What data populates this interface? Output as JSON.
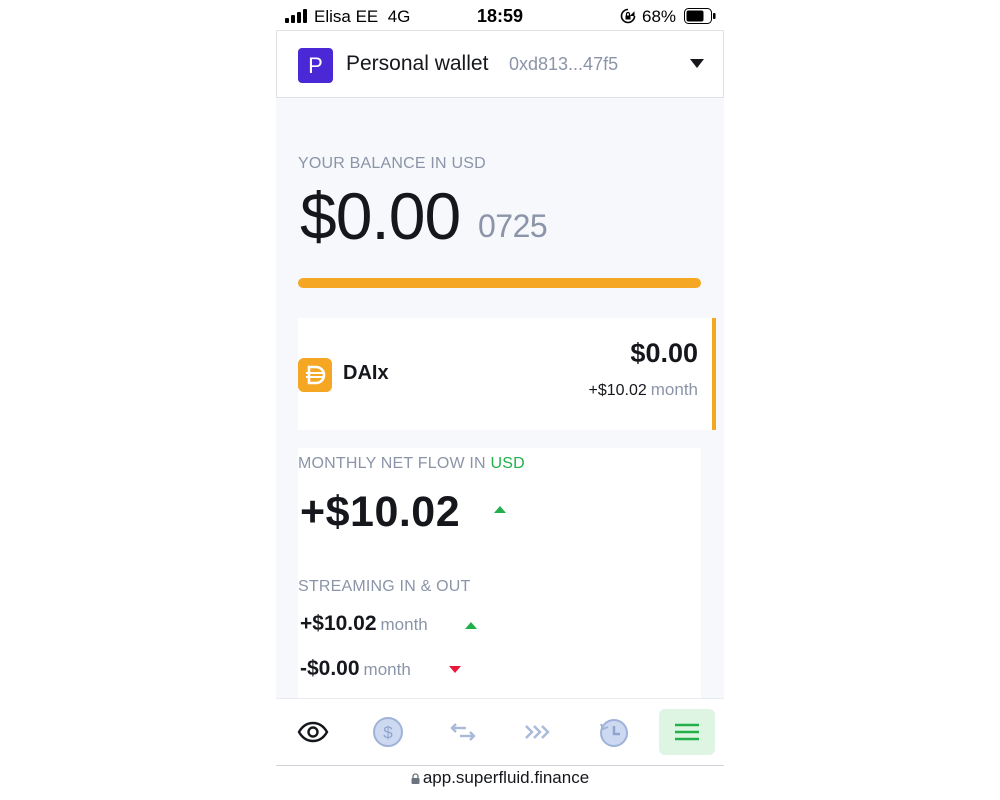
{
  "status_bar": {
    "carrier": "Elisa EE",
    "network": "4G",
    "time": "18:59",
    "battery_percent": "68%"
  },
  "wallet": {
    "avatar_letter": "P",
    "name": "Personal wallet",
    "address": "0xd813...47f5"
  },
  "balance": {
    "label": "YOUR BALANCE IN USD",
    "amount_main": "$0.00",
    "amount_fraction": "0725"
  },
  "token": {
    "name": "DAIx",
    "value": "$0.00",
    "flow": "+$10.02",
    "flow_unit": "month"
  },
  "net_flow": {
    "label": "MONTHLY NET FLOW IN",
    "label_currency": "USD",
    "value": "+$10.02"
  },
  "streaming": {
    "label": "STREAMING IN & OUT",
    "incoming": "+$10.02",
    "incoming_unit": "month",
    "outgoing": "-$0.00",
    "outgoing_unit": "month"
  },
  "bottom_nav": {
    "items": [
      {
        "icon": "eye-icon",
        "active": false
      },
      {
        "icon": "dollar-coin-icon",
        "active": false
      },
      {
        "icon": "swap-arrows-icon",
        "active": false
      },
      {
        "icon": "stream-chevrons-icon",
        "active": false
      },
      {
        "icon": "history-clock-icon",
        "active": false
      },
      {
        "icon": "menu-icon",
        "active": true
      }
    ]
  },
  "url": "app.superfluid.finance",
  "colors": {
    "brand_purple": "#4a28d6",
    "accent_orange": "#f5a623",
    "positive_green": "#21b04b",
    "negative_red": "#e8173c",
    "muted_text": "#8b94a8"
  }
}
